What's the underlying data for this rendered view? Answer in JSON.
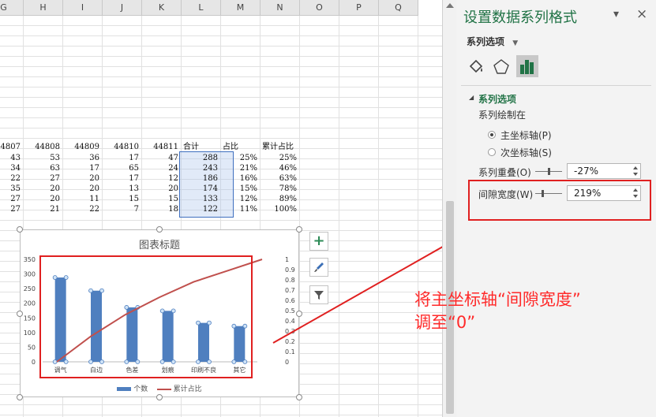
{
  "sheet": {
    "columns": [
      "G",
      "H",
      "I",
      "J",
      "K",
      "L",
      "M",
      "N",
      "O",
      "P",
      "Q"
    ],
    "header_row": [
      "44807",
      "44808",
      "44809",
      "44810",
      "44811",
      "合计",
      "占比",
      "累计占比"
    ],
    "rows": [
      [
        "43",
        "53",
        "36",
        "17",
        "47",
        "288",
        "25%",
        "25%"
      ],
      [
        "34",
        "63",
        "17",
        "65",
        "24",
        "243",
        "21%",
        "46%"
      ],
      [
        "22",
        "27",
        "20",
        "17",
        "12",
        "186",
        "16%",
        "63%"
      ],
      [
        "35",
        "20",
        "20",
        "13",
        "20",
        "174",
        "15%",
        "78%"
      ],
      [
        "27",
        "20",
        "11",
        "15",
        "15",
        "133",
        "12%",
        "89%"
      ],
      [
        "27",
        "21",
        "22",
        "7",
        "18",
        "122",
        "11%",
        "100%"
      ]
    ]
  },
  "chart": {
    "title": "图表标题",
    "legend": [
      "个数",
      "累计占比"
    ],
    "colors": {
      "bar": "#4f7fbf",
      "line": "#c0504d"
    },
    "buttons": [
      "chart-elements-plus-icon",
      "chart-styles-brush-icon",
      "chart-filter-icon"
    ]
  },
  "chart_data": {
    "type": "bar",
    "title": "图表标题",
    "categories": [
      "调气",
      "白边",
      "色差",
      "划痕",
      "印刷不良",
      "其它"
    ],
    "series": [
      {
        "name": "个数",
        "type": "bar",
        "axis": "primary",
        "values": [
          288,
          243,
          186,
          174,
          133,
          122
        ]
      },
      {
        "name": "累计占比",
        "type": "line",
        "axis": "secondary",
        "values": [
          0.25,
          0.46,
          0.63,
          0.78,
          0.89,
          1.0
        ]
      }
    ],
    "y_ticks": [
      "350",
      "300",
      "250",
      "200",
      "150",
      "100",
      "50",
      "0"
    ],
    "y2_ticks": [
      "1",
      "0.9",
      "0.8",
      "0.7",
      "0.6",
      "0.5",
      "0.4",
      "0.3",
      "0.2",
      "0.1",
      "0"
    ],
    "ylim": [
      0,
      350
    ],
    "y2lim": [
      0,
      1
    ],
    "legend_position": "bottom"
  },
  "panel": {
    "title": "设置数据系列格式",
    "dropdown": "系列选项",
    "section_title": "系列选项",
    "plot_on": "系列绘制在",
    "primary_axis": "主坐标轴(P)",
    "secondary_axis": "次坐标轴(S)",
    "overlap_label": "系列重叠(O)",
    "overlap_value": "-27%",
    "gap_label": "间隙宽度(W)",
    "gap_value": "219%",
    "close": "×",
    "minimize": "▾",
    "icons": [
      "paint-bucket-icon",
      "pentagon-icon",
      "bar-chart-icon"
    ]
  },
  "annotation": {
    "line1": "将主坐标轴“间隙宽度”",
    "line2": "调至“0”",
    "color": "#ff2a2a"
  }
}
